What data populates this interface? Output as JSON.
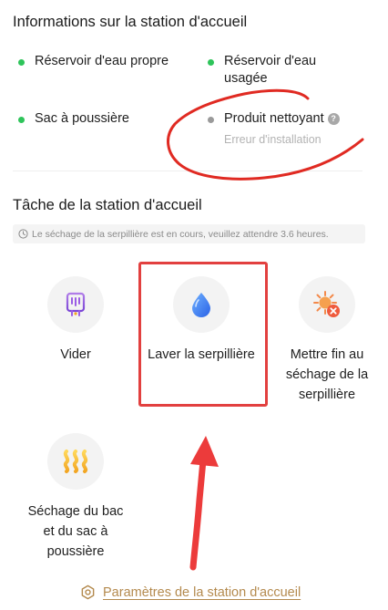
{
  "station_info": {
    "title": "Informations sur la station d'accueil",
    "items": [
      {
        "label": "Réservoir d'eau propre",
        "status": "ok",
        "color": "#2ec45a"
      },
      {
        "label": "Réservoir d'eau usagée",
        "status": "ok",
        "color": "#2ec45a"
      },
      {
        "label": "Sac à poussière",
        "status": "ok",
        "color": "#2ec45a"
      },
      {
        "label": "Produit nettoyant",
        "status": "not-installed",
        "color": "#9a9a9a",
        "sublabel": "Erreur d'installation"
      }
    ]
  },
  "tasks": {
    "title": "Tâche de la station d'accueil",
    "notice": "Le séchage de la serpillière est en cours, veuillez attendre 3.6 heures.",
    "actions": [
      {
        "label": "Vider",
        "icon": "empty-bin-icon"
      },
      {
        "label": "Laver la serpillière",
        "icon": "water-drop-icon"
      },
      {
        "label": "Mettre fin au séchage de la serpillière",
        "icon": "stop-drying-icon"
      },
      {
        "label": "Séchage du bac et du sac à poussière",
        "icon": "heat-waves-icon"
      }
    ]
  },
  "footer": {
    "settings_link": "Paramètres de la station d'accueil",
    "icon": "gear-hexagon-icon"
  },
  "colors": {
    "accent_gold": "#b48a4e",
    "ok_green": "#2ec45a",
    "annotation_red": "#e2403f"
  }
}
